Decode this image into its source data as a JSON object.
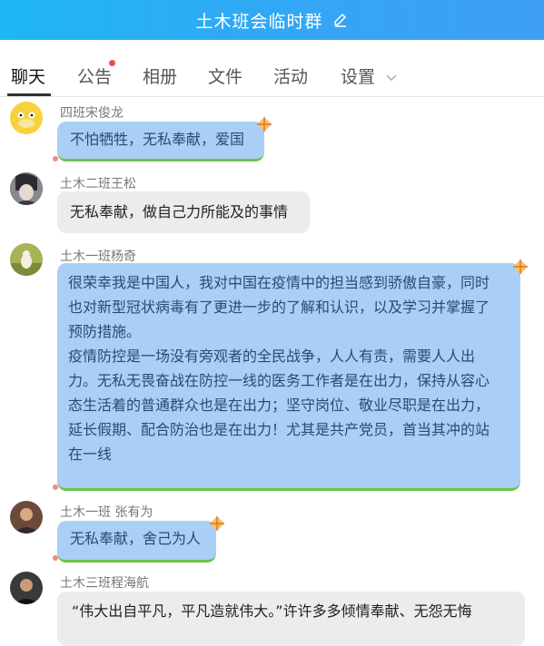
{
  "header": {
    "title": "土木班会临时群",
    "edit_icon": "pencil-icon"
  },
  "tabs": [
    {
      "label": "聊天",
      "active": true
    },
    {
      "label": "公告",
      "has_badge": true
    },
    {
      "label": "相册"
    },
    {
      "label": "文件"
    },
    {
      "label": "活动"
    },
    {
      "label": "设置",
      "has_dropdown": true
    }
  ],
  "messages": [
    {
      "sender": "四班宋俊龙",
      "text": "不怕牺牲，无私奉献，爱国",
      "style": "blue"
    },
    {
      "sender": "土木二班王松",
      "text": "无私奉献，做自己力所能及的事情",
      "style": "gray"
    },
    {
      "sender": "土木一班杨奇",
      "lines": [
        "很荣幸我是中国人，我对中国在疫情中的担当感到骄傲自豪，同时",
        "也对新型冠状病毒有了更进一步的了解和认识，以及学习并掌握了",
        "预防措施。",
        "疫情防控是一场没有旁观者的全民战争，人人有责，需要人人出",
        "力。无私无畏奋战在防控一线的医务工作者是在出力，保持从容心",
        "态生活着的普通群众也是在出力；坚守岗位、敬业尽职是在出力，",
        "延长假期、配合防治也是在出力！尤其是共产党员，首当其冲的站",
        "在一线"
      ],
      "style": "blue"
    },
    {
      "sender": "土木一班 张有为",
      "text": "无私奉献，舍己为人",
      "style": "blue"
    },
    {
      "sender": "土木三班程海航",
      "text": "“伟大出自平凡，平凡造就伟大。”许许多多倾情奉献、无怨无悔",
      "style": "gray"
    }
  ],
  "colors": {
    "header": "#1fb6f4",
    "bubble_blue": "#aacff7",
    "bubble_gray": "#ececec",
    "badge": "#f14c4c"
  }
}
